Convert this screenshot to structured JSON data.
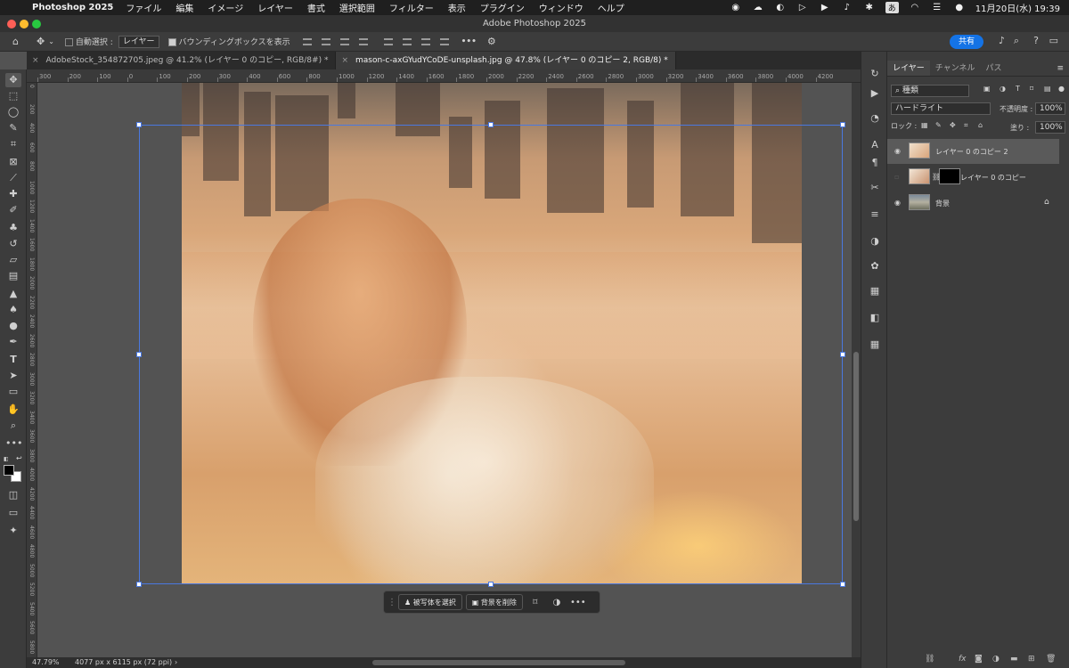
{
  "menubar": {
    "app_name": "Photoshop 2025",
    "items": [
      "ファイル",
      "編集",
      "イメージ",
      "レイヤー",
      "書式",
      "選択範囲",
      "フィルター",
      "表示",
      "プラグイン",
      "ウィンドウ",
      "ヘルプ"
    ],
    "ime": "あ",
    "clock": "11月20日(水)  19:39"
  },
  "window": {
    "title": "Adobe Photoshop 2025"
  },
  "options_bar": {
    "auto_select_label": "自動選択 :",
    "auto_select_target": "レイヤー",
    "bounding_box_label": "バウンディングボックスを表示",
    "share_label": "共有",
    "more_label": "•••"
  },
  "tabs": [
    {
      "label": "AdobeStock_354872705.jpeg @ 41.2% (レイヤー 0 のコピー, RGB/8#) *",
      "active": false
    },
    {
      "label": "mason-c-axGYudYCoDE-unsplash.jpg @ 47.8% (レイヤー 0 のコピー 2, RGB/8) *",
      "active": true
    }
  ],
  "ruler": {
    "top_ticks": [
      "300",
      "200",
      "100",
      "0",
      "100",
      "200",
      "300",
      "400",
      "600",
      "800",
      "1000",
      "1200",
      "1400",
      "1600",
      "1800",
      "2000",
      "2200",
      "2400",
      "2600",
      "2800",
      "3000",
      "3200",
      "3400",
      "3600",
      "3800",
      "4000",
      "4200"
    ],
    "left_ticks": [
      "0",
      "2 0 0",
      "4 0 0",
      "6 0 0",
      "8 0 0",
      "1 0 0 0",
      "1 2 0 0",
      "1 4 0 0",
      "1 6 0 0",
      "1 8 0 0",
      "2 0 0 0",
      "2 2 0 0",
      "2 4 0 0",
      "2 6 0 0",
      "2 8 0 0",
      "3 0 0 0",
      "3 2 0 0",
      "3 4 0 0",
      "3 6 0 0",
      "3 8 0 0",
      "4 0 0 0",
      "4 2 0 0",
      "4 4 0 0",
      "4 6 0 0",
      "4 8 0 0",
      "5 0 0 0",
      "5 2 0 0",
      "5 4 0 0",
      "5 6 0 0",
      "5 8 0 0"
    ]
  },
  "contextual_taskbar": {
    "select_subject": "被写体を選択",
    "remove_background": "背景を削除",
    "more": "•••"
  },
  "status": {
    "zoom": "47.79%",
    "dimensions": "4077 px x 6115 px (72 ppi)"
  },
  "layers_panel": {
    "tabs": [
      "レイヤー",
      "チャンネル",
      "パス"
    ],
    "filter_kind": "種類",
    "blend_mode": "ハードライト",
    "opacity_label": "不透明度 :",
    "opacity_value": "100%",
    "lock_label": "ロック :",
    "fill_label": "塗り :",
    "fill_value": "100%",
    "layers": [
      {
        "name": "レイヤー 0 のコピー 2",
        "selected": true,
        "visible": true,
        "has_mask": false,
        "locked": false
      },
      {
        "name": "レイヤー 0 のコピー",
        "selected": false,
        "visible": false,
        "has_mask": true,
        "locked": false
      },
      {
        "name": "背景",
        "selected": false,
        "visible": true,
        "has_mask": false,
        "locked": true
      }
    ]
  },
  "colors": {
    "accent": "#1473e6",
    "selection": "#5a5a5a",
    "transform_box": "#4a78e0"
  }
}
